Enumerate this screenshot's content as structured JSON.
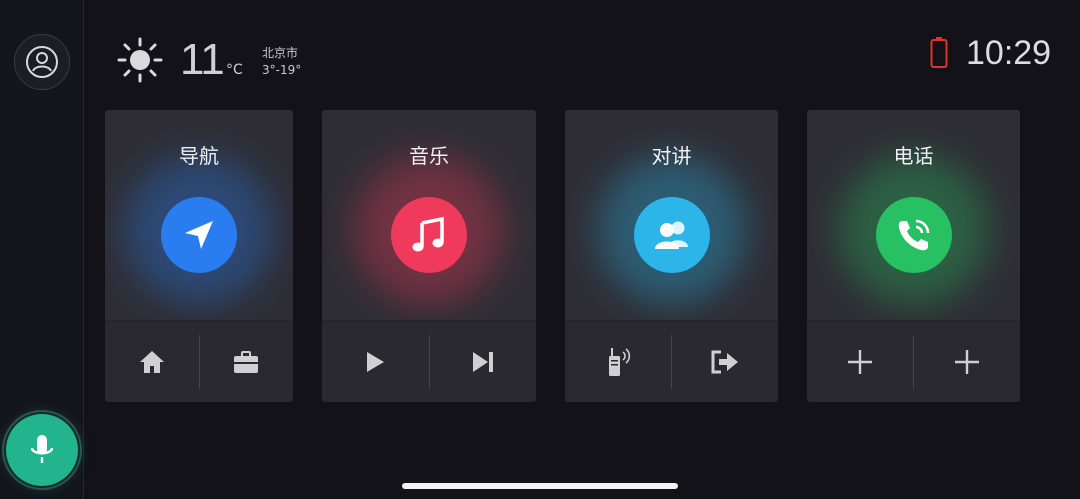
{
  "status": {
    "temperature": "11",
    "temp_unit": "°C",
    "city": "北京市",
    "temp_range": "3°-19°",
    "time": "10:29",
    "weather_icon": "sun-icon",
    "battery_color": "#e0322e"
  },
  "cards": [
    {
      "title": "导航",
      "icon": "navigation-arrow-icon",
      "color": "#2a7df0",
      "actions": [
        "home-icon",
        "briefcase-icon"
      ]
    },
    {
      "title": "音乐",
      "icon": "music-note-icon",
      "color": "#f03a5c",
      "actions": [
        "play-icon",
        "skip-next-icon"
      ]
    },
    {
      "title": "对讲",
      "icon": "people-icon",
      "color": "#2bb5e8",
      "actions": [
        "walkie-talkie-icon",
        "exit-icon"
      ]
    },
    {
      "title": "电话",
      "icon": "phone-call-icon",
      "color": "#27c063",
      "actions": [
        "plus-icon",
        "plus-icon"
      ]
    }
  ],
  "rail": {
    "avatar_icon": "user-avatar-icon",
    "voice_icon": "microphone-icon",
    "voice_color": "#22b48c"
  }
}
